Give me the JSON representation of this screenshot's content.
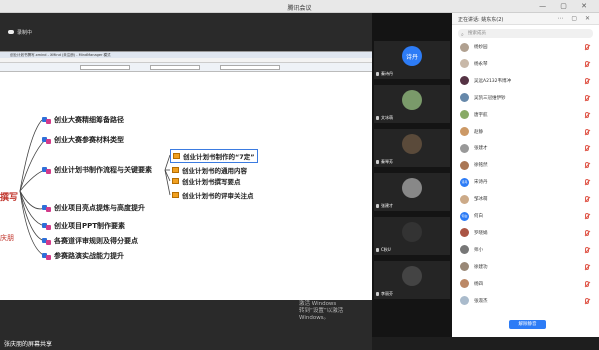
{
  "window": {
    "title": "腾讯会议"
  },
  "recording": {
    "label": "录制中"
  },
  "app": {
    "title": "创业计划书撰写.xmind - XMind (未注册) - MindManager 模式"
  },
  "mindmap": {
    "root_fragment": "撰写",
    "left_fragment": "庆朋",
    "branches": [
      "创业大赛精细筹备路径",
      "创业大赛参赛材料类型",
      "创业计划书制作流程与关键要素",
      "创业项目亮点提炼与高度提升",
      "创业项目PPT制作要素",
      "各赛道评审规则及得分要点",
      "参赛路演实战能力提升"
    ],
    "subtopics": [
      "创业计划书制作的“7定”",
      "创业计划书的通用内容",
      "创业计划书撰写要点",
      "创业计划书的评审关注点"
    ]
  },
  "watermark": {
    "line1": "激活 Windows",
    "line2": "转到“设置”以激活 Windows。"
  },
  "share": {
    "presenter_label": "张庆朋的屏幕共享"
  },
  "video_tiles": [
    {
      "name": "秦诗丹",
      "avatar_text": "诗丹",
      "avatar_color": "#2d7cf6"
    },
    {
      "name": "文冰萌",
      "avatar_text": "",
      "avatar_color": "#7a9a6a"
    },
    {
      "name": "秦琴芳",
      "avatar_text": "",
      "avatar_color": "#5a4a3a"
    },
    {
      "name": "张建才",
      "avatar_text": "",
      "avatar_color": "#888888"
    },
    {
      "name": "C秋U",
      "avatar_text": "",
      "avatar_color": "#333333"
    },
    {
      "name": "李丽芬",
      "avatar_text": "",
      "avatar_color": "#444444"
    }
  ],
  "panel": {
    "title": "正在讲话: 姚东东(2)",
    "search_placeholder": "搜索成员",
    "unmute_button": "解除静音",
    "members": [
      {
        "name": "杨妙园",
        "color": "#b0a090"
      },
      {
        "name": "杨永琴",
        "color": "#c8b8a8"
      },
      {
        "name": "吴远A2132韦博冲",
        "color": "#553344"
      },
      {
        "name": "吴凯三冠维伊钞",
        "color": "#6688aa"
      },
      {
        "name": "唐宇航",
        "color": "#88aa66"
      },
      {
        "name": "赵静",
        "color": "#cc9966"
      },
      {
        "name": "张建才",
        "color": "#999999"
      },
      {
        "name": "徐铭然",
        "color": "#aa7755"
      },
      {
        "name": "宋诗丹",
        "color": "#2d7cf6",
        "avatar_text": "诗丹"
      },
      {
        "name": "邹冰萌",
        "color": "#ccaa88"
      },
      {
        "name": "何白",
        "color": "#2d7cf6",
        "avatar_text": "何白"
      },
      {
        "name": "罗晓娟",
        "color": "#aa5544"
      },
      {
        "name": "师小",
        "color": "#777777"
      },
      {
        "name": "徐建功",
        "color": "#998877"
      },
      {
        "name": "杨四",
        "color": "#bb8866"
      },
      {
        "name": "张淑杰",
        "color": "#aabbcc"
      }
    ]
  },
  "colors": {
    "accent": "#2d7cf6",
    "mic_off": "#e05a4d",
    "root": "#c0342b"
  }
}
